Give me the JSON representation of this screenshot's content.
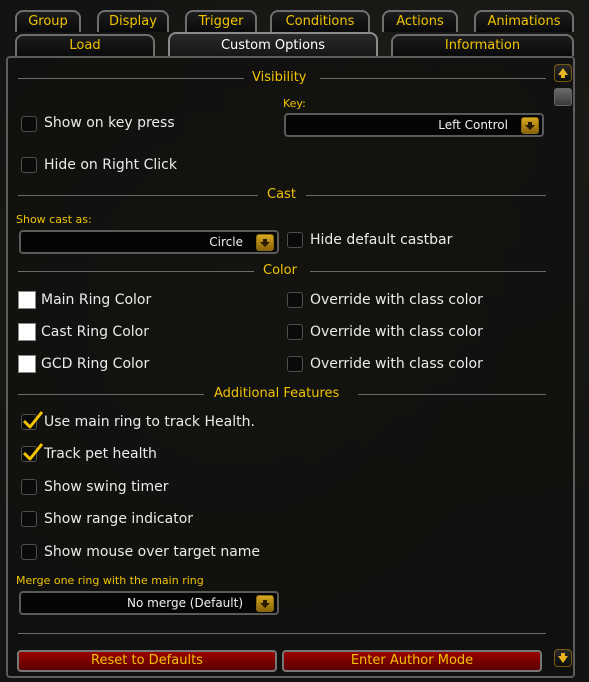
{
  "tabs_row1": [
    "Group",
    "Display",
    "Trigger",
    "Conditions",
    "Actions",
    "Animations"
  ],
  "tabs_row2": [
    "Load",
    "Custom Options",
    "Information"
  ],
  "active_tab": "Custom Options",
  "sections": {
    "visibility": "Visibility",
    "cast": "Cast",
    "color": "Color",
    "additional": "Additional Features"
  },
  "visibility": {
    "show_on_key_press": {
      "label": "Show on key press",
      "checked": false
    },
    "key_label": "Key:",
    "key_value": "Left Control",
    "hide_on_right_click": {
      "label": "Hide on Right Click",
      "checked": false
    }
  },
  "cast": {
    "show_cast_as_label": "Show cast as:",
    "show_cast_as_value": "Circle",
    "hide_default_castbar": {
      "label": "Hide default castbar",
      "checked": false
    }
  },
  "color": {
    "main_ring": "Main Ring Color",
    "cast_ring": "Cast Ring Color",
    "gcd_ring": "GCD Ring Color",
    "swatch_color": "#ffffff",
    "override_label": "Override with class color"
  },
  "additional": {
    "track_health": {
      "label": "Use main ring to track Health.",
      "checked": true
    },
    "track_pet_health": {
      "label": "Track pet health",
      "checked": true
    },
    "swing_timer": {
      "label": "Show swing timer",
      "checked": false
    },
    "range_indicator": {
      "label": "Show range indicator",
      "checked": false
    },
    "mouseover_name": {
      "label": "Show mouse over target name",
      "checked": false
    },
    "merge_label": "Merge one ring with the main ring",
    "merge_value": "No merge (Default)"
  },
  "buttons": {
    "reset": "Reset to Defaults",
    "author_mode": "Enter Author Mode"
  },
  "colors": {
    "accent": "#f0c400",
    "button_red": "#8a0000"
  }
}
